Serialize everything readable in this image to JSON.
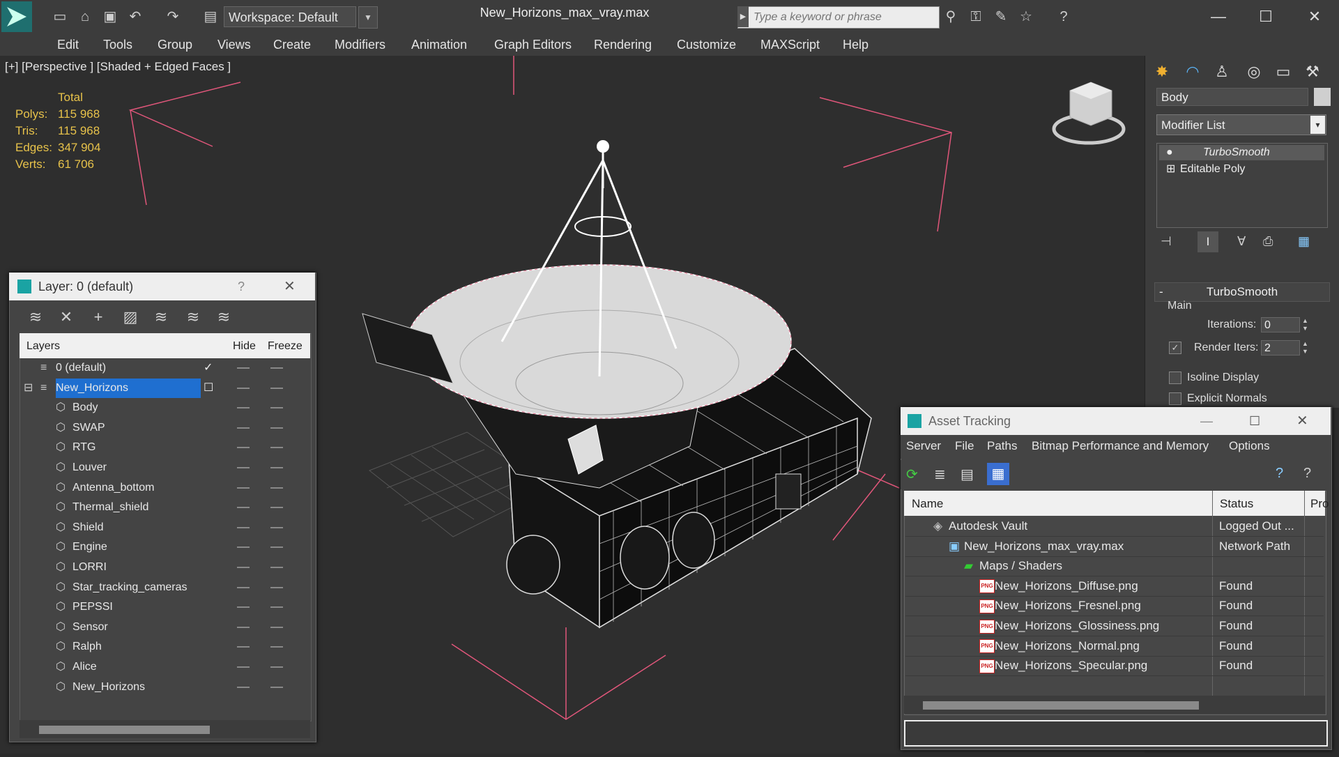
{
  "titlebar": {
    "workspace": "Workspace: Default",
    "document_title": "New_Horizons_max_vray.max",
    "search_placeholder": "Type a keyword or phrase",
    "minimize": "—",
    "maximize": "☐",
    "close": "✕"
  },
  "menu": [
    "Edit",
    "Tools",
    "Group",
    "Views",
    "Create",
    "Modifiers",
    "Animation",
    "Graph Editors",
    "Rendering",
    "Customize",
    "MAXScript",
    "Help"
  ],
  "viewport": {
    "label": "[+] [Perspective ] [Shaded + Edged Faces ]",
    "stats_header": "Total",
    "stats": [
      {
        "label": "Polys:",
        "value": "115 968"
      },
      {
        "label": "Tris:",
        "value": "115 968"
      },
      {
        "label": "Edges:",
        "value": "347 904"
      },
      {
        "label": "Verts:",
        "value": "61 706"
      }
    ]
  },
  "command_panel": {
    "object_name": "Body",
    "modifier_list": "Modifier List",
    "stack": [
      "TurboSmooth",
      "Editable Poly"
    ],
    "rollout_title": "TurboSmooth",
    "group_main": "Main",
    "iterations_label": "Iterations:",
    "iterations_value": "0",
    "render_iters_label": "Render Iters:",
    "render_iters_value": "2",
    "isoline_label": "Isoline Display",
    "explicit_label": "Explicit Normals"
  },
  "layer_dialog": {
    "title": "Layer: 0 (default)",
    "help": "?",
    "columns": [
      "Layers",
      "Hide",
      "Freeze"
    ],
    "rows": [
      {
        "name": "0 (default)",
        "level": 0
      },
      {
        "name": "New_Horizons",
        "level": 0,
        "selected": true
      },
      {
        "name": "Body",
        "level": 1
      },
      {
        "name": "SWAP",
        "level": 1
      },
      {
        "name": "RTG",
        "level": 1
      },
      {
        "name": "Louver",
        "level": 1
      },
      {
        "name": "Antenna_bottom",
        "level": 1
      },
      {
        "name": "Thermal_shield",
        "level": 1
      },
      {
        "name": "Shield",
        "level": 1
      },
      {
        "name": "Engine",
        "level": 1
      },
      {
        "name": "LORRI",
        "level": 1
      },
      {
        "name": "Star_tracking_cameras",
        "level": 1
      },
      {
        "name": "PEPSSI",
        "level": 1
      },
      {
        "name": "Sensor",
        "level": 1
      },
      {
        "name": "Ralph",
        "level": 1
      },
      {
        "name": "Alice",
        "level": 1
      },
      {
        "name": "New_Horizons",
        "level": 1
      }
    ]
  },
  "asset_dialog": {
    "title": "Asset Tracking",
    "menu": [
      "Server",
      "File",
      "Paths",
      "Bitmap Performance and Memory",
      "Options"
    ],
    "columns": [
      "Name",
      "Status",
      "Pro"
    ],
    "rows": [
      {
        "name": "Autodesk Vault",
        "status": "Logged Out ...",
        "indent": 0,
        "icon": "vault"
      },
      {
        "name": "New_Horizons_max_vray.max",
        "status": "Network Path",
        "indent": 1,
        "icon": "max"
      },
      {
        "name": "Maps / Shaders",
        "status": "",
        "indent": 2,
        "icon": "folder"
      },
      {
        "name": "New_Horizons_Diffuse.png",
        "status": "Found",
        "indent": 3,
        "icon": "png"
      },
      {
        "name": "New_Horizons_Fresnel.png",
        "status": "Found",
        "indent": 3,
        "icon": "png"
      },
      {
        "name": "New_Horizons_Glossiness.png",
        "status": "Found",
        "indent": 3,
        "icon": "png"
      },
      {
        "name": "New_Horizons_Normal.png",
        "status": "Found",
        "indent": 3,
        "icon": "png"
      },
      {
        "name": "New_Horizons_Specular.png",
        "status": "Found",
        "indent": 3,
        "icon": "png"
      }
    ]
  },
  "colors": {
    "stats": "#e7c24a",
    "selection": "#1f6fd0",
    "camera_lines": "#e0567a",
    "title_icon": "#1aa3a3"
  }
}
